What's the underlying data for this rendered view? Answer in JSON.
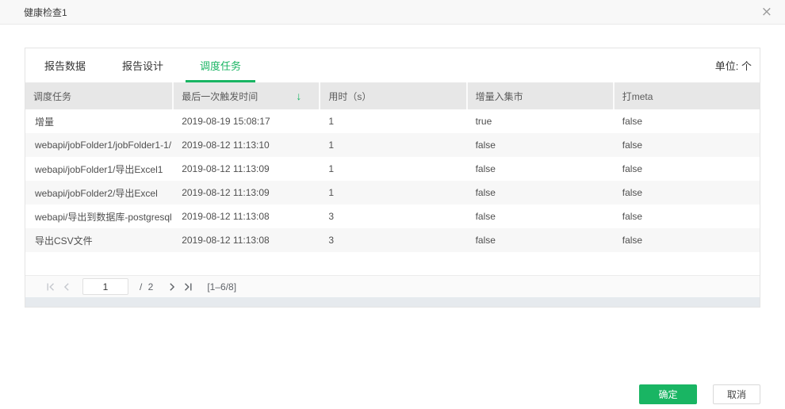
{
  "dialog": {
    "title": "健康检查1",
    "close_glyph": "×"
  },
  "tabs": {
    "items": [
      {
        "label": "报告数据",
        "active": false
      },
      {
        "label": "报告设计",
        "active": false
      },
      {
        "label": "调度任务",
        "active": true
      }
    ],
    "unit_label": "单位: 个"
  },
  "table": {
    "columns": [
      {
        "label": "调度任务"
      },
      {
        "label": "最后一次触发时间",
        "sorted": "desc",
        "sort_glyph": "↓"
      },
      {
        "label": "用时（s）"
      },
      {
        "label": "增量入集市"
      },
      {
        "label": "打meta"
      }
    ],
    "rows": [
      [
        "增量",
        "2019-08-19 15:08:17",
        "1",
        "true",
        "false"
      ],
      [
        "webapi/jobFolder1/jobFolder1-1/",
        "2019-08-12 11:13:10",
        "1",
        "false",
        "false"
      ],
      [
        "webapi/jobFolder1/导出Excel1",
        "2019-08-12 11:13:09",
        "1",
        "false",
        "false"
      ],
      [
        "webapi/jobFolder2/导出Excel",
        "2019-08-12 11:13:09",
        "1",
        "false",
        "false"
      ],
      [
        "webapi/导出到数据库-postgresql",
        "2019-08-12 11:13:08",
        "3",
        "false",
        "false"
      ],
      [
        "导出CSV文件",
        "2019-08-12 11:13:08",
        "3",
        "false",
        "false"
      ]
    ]
  },
  "pagination": {
    "current_page": "1",
    "total_pages_label": "/ 2",
    "range_label": "[1–6/8]"
  },
  "footer": {
    "ok_label": "确定",
    "cancel_label": "取消"
  },
  "colors": {
    "accent_green": "#19b563",
    "header_bg": "#e7e7e7",
    "row_stripe": "#f7f7f7"
  }
}
